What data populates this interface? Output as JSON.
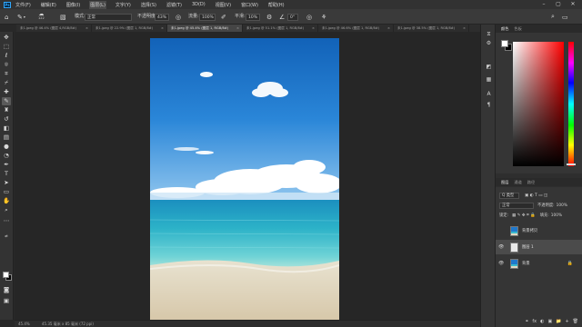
{
  "menu": [
    "文件(F)",
    "编辑(E)",
    "图像(I)",
    "图层(L)",
    "文字(Y)",
    "选择(S)",
    "滤镜(T)",
    "3D(D)",
    "视图(V)",
    "窗口(W)",
    "帮助(H)"
  ],
  "menu_active_index": 3,
  "logo": "Ps",
  "options": {
    "brush_size": "122",
    "mode_label": "模式:",
    "mode_value": "正常",
    "opacity_label": "不透明度:",
    "opacity_value": "43%",
    "flow_label": "流量:",
    "flow_value": "100%",
    "smoothing_label": "平滑:",
    "smoothing_value": "10%",
    "angle_value": "0°"
  },
  "tabs": [
    {
      "label": "未1.jpeg @ 46.4% (图层 4,RGB/8#)",
      "active": false
    },
    {
      "label": "未1.jpeg @ 22.9% (图层 1, RGB/8#)",
      "active": false
    },
    {
      "label": "未1.jpeg @ 45.4% (图层 1, RGB/8#)",
      "active": true
    },
    {
      "label": "未1.jpeg @ 51.1% (图层 1, RGB/8#)",
      "active": false
    },
    {
      "label": "未1.jpeg @ 46.6% (图层 1, RGB/8#)",
      "active": false
    },
    {
      "label": "未1.jpeg @ 38.5% (图层 1, RGB/8#)",
      "active": false
    }
  ],
  "tab_close": "×",
  "status": {
    "zoom": "45.4%",
    "doc_info": "45.35 毫米 x 85 毫米 (72 ppi)"
  },
  "panels": {
    "color_tabs": [
      "颜色",
      "色板"
    ],
    "layers_tabs": [
      "图层",
      "通道",
      "路径"
    ],
    "kind_label": "Q 类型",
    "blend_mode": "正常",
    "opacity_label": "不透明度:",
    "opacity_value": "100%",
    "lock_label": "锁定:",
    "fill_label": "填充:",
    "fill_value": "100%",
    "footer_icons": [
      "fx",
      "◐",
      "▣",
      "📁",
      "+",
      "🗑"
    ]
  },
  "layers": [
    {
      "name": "背景拷贝",
      "visible": false,
      "thumb": "sea",
      "selected": false,
      "locked": false
    },
    {
      "name": "图层 1",
      "visible": true,
      "thumb": "white",
      "selected": true,
      "locked": false
    },
    {
      "name": "背景",
      "visible": true,
      "thumb": "sea",
      "selected": false,
      "locked": true
    }
  ],
  "colors": {
    "foreground": "#ffffff",
    "background": "#000000",
    "accent": "#31a8ff"
  },
  "icons": {
    "left_tools": [
      "move-icon",
      "marquee-icon",
      "lasso-icon",
      "quick-select-icon",
      "crop-icon",
      "eyedropper-icon",
      "healing-icon",
      "brush-icon",
      "stamp-icon",
      "history-brush-icon",
      "eraser-icon",
      "gradient-icon",
      "blur-icon",
      "dodge-icon",
      "pen-icon",
      "type-icon",
      "path-select-icon",
      "shape-icon",
      "hand-icon",
      "zoom-icon",
      "more-icon",
      "swap-icon",
      "mask-icon",
      "screen-mode-icon"
    ],
    "right_strip": [
      "history-icon",
      "properties-icon",
      "adjust-icon",
      "character-icon",
      "paragraph-icon",
      "glyph-icon"
    ]
  }
}
